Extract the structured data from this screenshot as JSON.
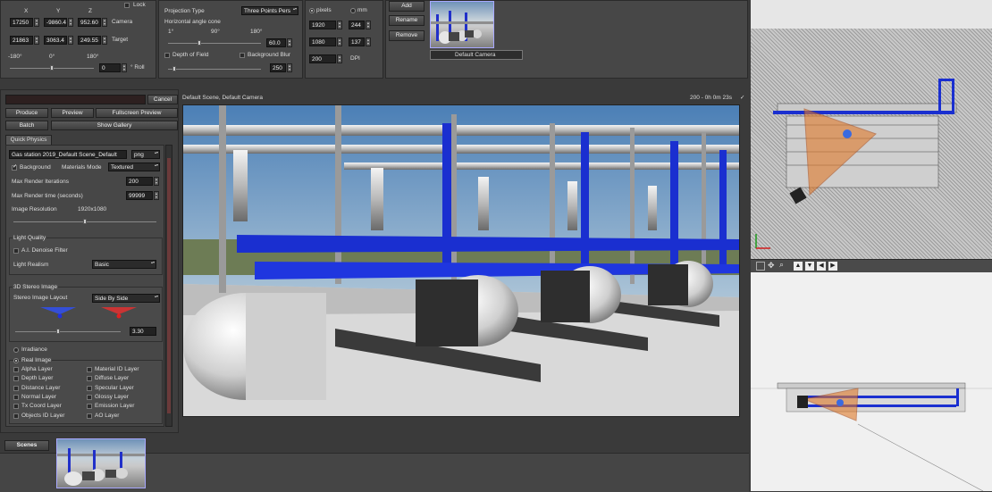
{
  "camera": {
    "axes": [
      "X",
      "Y",
      "Z"
    ],
    "lock_label": "Lock",
    "camera_label": "Camera",
    "target_label": "Target",
    "camera_values": [
      "17250",
      "-9860.4",
      "952.60"
    ],
    "target_values": [
      "21863",
      "3063.4",
      "249.55"
    ],
    "roll_ticks": [
      "-180°",
      "0°",
      "180°"
    ],
    "roll_value": "0",
    "roll_label": "° Roll",
    "roll_level": 0.5
  },
  "projection": {
    "type_label": "Projection Type",
    "type_value": "Three Points Pers",
    "cone_label": "Horizontal angle cone",
    "cone_ticks": [
      "1°",
      "90°",
      "180°"
    ],
    "cone_value": "60.0",
    "cone_level": 0.33,
    "dof_label": "Depth of Field",
    "blur_label": "Background Blur",
    "blur_value": "250",
    "blur_level": 0.05
  },
  "resolution": {
    "pixels_label": "pixels",
    "mm_label": "mm",
    "width_px": "1920",
    "width_mm": "244",
    "height_px": "1080",
    "height_mm": "137",
    "dpi_value": "200",
    "dpi_label": "DPI"
  },
  "camera_list": {
    "add": "Add",
    "rename": "Rename",
    "remove": "Remove",
    "default_camera": "Default Camera"
  },
  "render": {
    "cancel": "Cancel",
    "produce": "Produce",
    "preview": "Preview",
    "fullscreen": "Fullscreen Preview",
    "batch": "Batch",
    "show_gallery": "Show Gallery",
    "tab": "Quick Physics",
    "file_name": "Gas station 2019_Default Scene_Default",
    "file_format": "png",
    "background_label": "Background",
    "materials_mode_label": "Materials Mode",
    "materials_mode_value": "Textured",
    "max_iter_label": "Max Render Iterations",
    "max_iter_value": "200",
    "max_time_label": "Max Render time (seconds)",
    "max_time_value": "99999",
    "image_res_label": "Image Resolution",
    "image_res_value": "1920x1080",
    "image_res_level": 0.5,
    "light_quality_title": "Light Quality",
    "denoise_label": "A.I. Denoise Filter",
    "light_realism_label": "Light Realism",
    "light_realism_value": "Basic",
    "stereo_title": "3D Stereo Image",
    "stereo_layout_label": "Stereo Image Layout",
    "stereo_layout_value": "Side By Side",
    "stereo_value": "3.30",
    "stereo_level": 0.4,
    "irradiance_label": "Irradiance",
    "real_image_label": "Real Image",
    "layers_left": [
      "Alpha Layer",
      "Depth Layer",
      "Distance Layer",
      "Normal Layer",
      "Tx Coord Layer",
      "Objects ID Layer"
    ],
    "layers_right": [
      "Material ID Layer",
      "Diffuse Layer",
      "Specular Layer",
      "Glossy Layer",
      "Emission Layer",
      "AO Layer"
    ]
  },
  "viewport": {
    "title": "Default Scene, Default Camera",
    "status": "200 - 0h 0m 23s"
  },
  "scenes": {
    "tab": "Scenes"
  },
  "colors": {
    "pipe_blue": "#1a2fd0",
    "camera_cone": "#e07a2a",
    "accent_frame": "#a8a8ff"
  }
}
